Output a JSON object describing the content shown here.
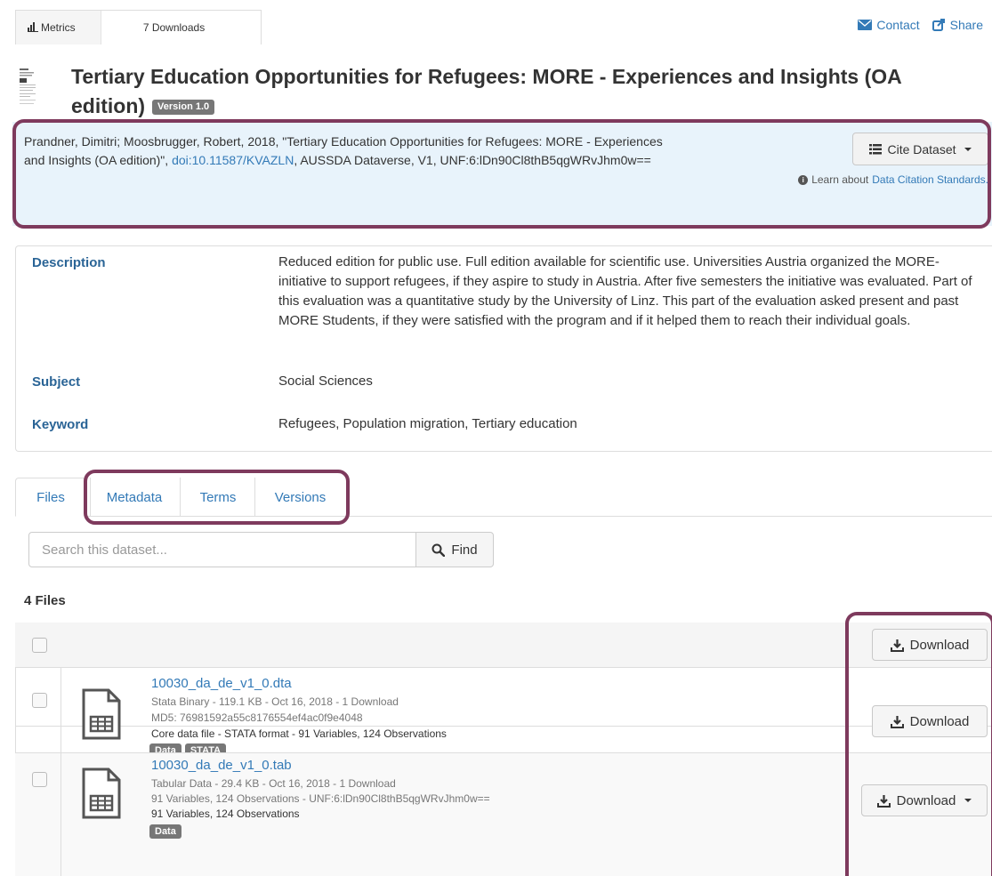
{
  "metrics": {
    "metrics_label": "Metrics",
    "downloads_label": "7 Downloads"
  },
  "top_links": {
    "contact": "Contact",
    "share": "Share"
  },
  "dataset": {
    "title": "Tertiary Education Opportunities for Refugees: MORE - Experiences and Insights (OA edition)",
    "version": "Version 1.0"
  },
  "citation": {
    "text_before": "Prandner, Dimitri; Moosbrugger, Robert, 2018, \"Tertiary Education Opportunities for Refugees: MORE - Experiences and Insights (OA edition)\", ",
    "doi": "doi:10.11587/KVAZLN",
    "text_after": ", AUSSDA Dataverse, V1, UNF:6:lDn90Cl8thB5qgWRvJhm0w==",
    "cite_button": "Cite Dataset",
    "learn_prefix": "Learn about",
    "learn_link": "Data Citation Standards."
  },
  "metadata": {
    "description_label": "Description",
    "description_value": "Reduced edition for public use. Full edition available for scientific use. Universities Austria organized the MORE-initiative to support refugees, if they aspire to study in Austria. After five semesters the initiative was evaluated. Part of this evaluation was a quantitative study by the University of Linz. This part of the evaluation asked present and past MORE Students, if they were satisfied with the program and if it helped them to reach their individual goals.",
    "subject_label": "Subject",
    "subject_value": "Social Sciences",
    "keyword_label": "Keyword",
    "keyword_value": "Refugees, Population migration, Tertiary education"
  },
  "tabs": [
    {
      "label": "Files",
      "active": true
    },
    {
      "label": "Metadata",
      "active": false
    },
    {
      "label": "Terms",
      "active": false
    },
    {
      "label": "Versions",
      "active": false
    }
  ],
  "search": {
    "placeholder": "Search this dataset...",
    "find_label": "Find"
  },
  "files": {
    "count_label": "4 Files",
    "header_download": "Download",
    "rows": [
      {
        "name": "10030_da_de_v1_0.dta",
        "detail1": "Stata Binary - 119.1 KB - Oct 16, 2018 - 1 Download",
        "detail2": "MD5: 76981592a55c8176554ef4ac0f9e4048",
        "description": "Core data file - STATA format - 91 Variables, 124 Observations",
        "tags": [
          "Data",
          "STATA"
        ],
        "download_label": "Download"
      },
      {
        "name": "10030_da_de_v1_0.tab",
        "detail1": "Tabular Data - 29.4 KB - Oct 16, 2018 - 1 Download",
        "detail2": "91 Variables, 124 Observations - UNF:6:lDn90Cl8thB5qgWRvJhm0w==",
        "description": "91 Variables, 124 Observations",
        "tags": [
          "Data"
        ],
        "download_label": "Download"
      }
    ]
  },
  "colors": {
    "link": "#337ab7",
    "highlight": "#7e3a5d",
    "citation_bg": "#e8f3fb",
    "badge": "#777777"
  }
}
